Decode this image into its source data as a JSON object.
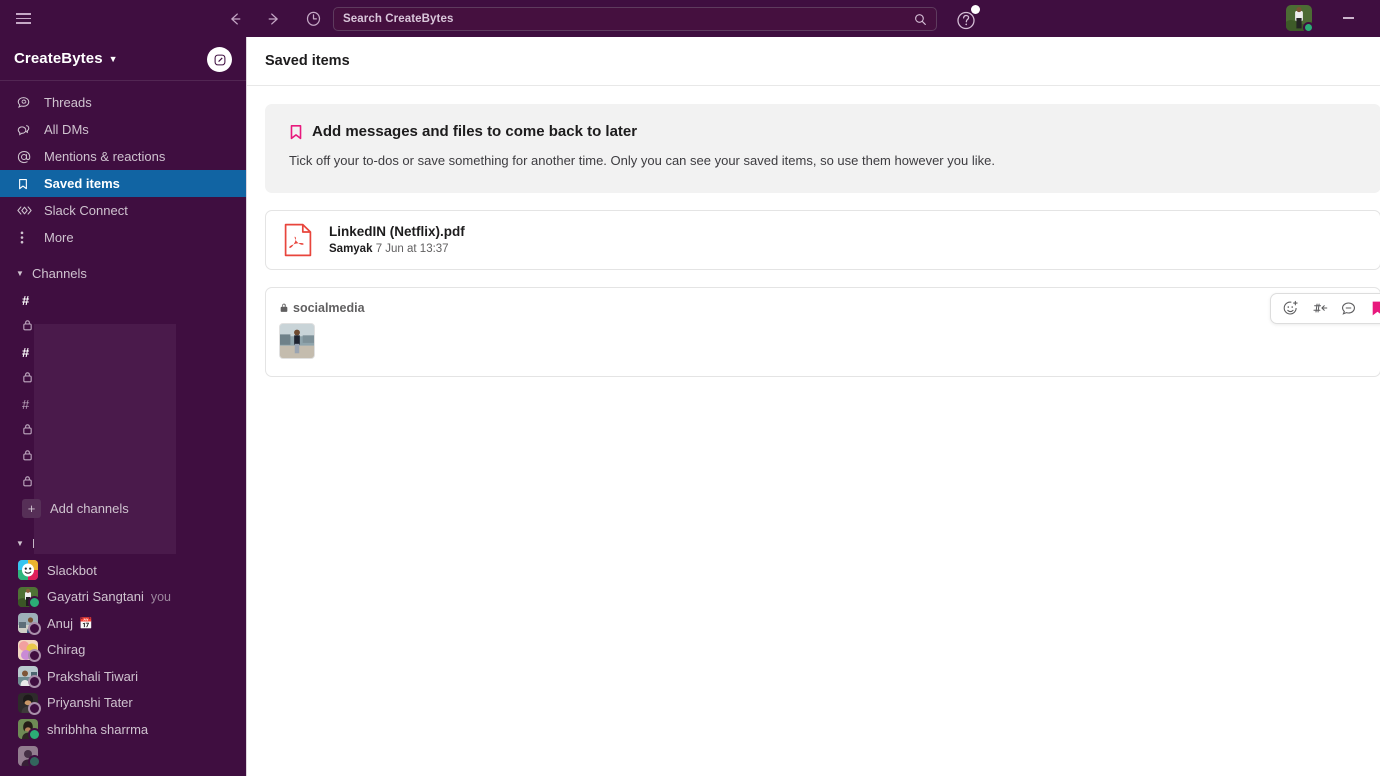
{
  "topbar": {
    "menu_icon": "hamburger-icon",
    "back_icon": "arrow-left-icon",
    "forward_icon": "arrow-right-icon",
    "history_icon": "clock-icon",
    "search_placeholder": "Search CreateBytes",
    "search_icon": "search-icon",
    "help_icon": "help-circle-icon",
    "help_badge": true,
    "avatar_name": "avatar",
    "presence": "active",
    "minimize_label": "Minimize"
  },
  "sidebar": {
    "workspace": "CreateBytes",
    "workspace_caret": "chevron-down-icon",
    "compose_icon": "compose-icon",
    "nav": [
      {
        "label": "Threads",
        "icon": "threads-icon",
        "active": false
      },
      {
        "label": "All DMs",
        "icon": "dms-icon",
        "active": false
      },
      {
        "label": "Mentions & reactions",
        "icon": "mentions-icon",
        "active": false
      },
      {
        "label": "Saved items",
        "icon": "bookmark-icon",
        "active": true
      },
      {
        "label": "Slack Connect",
        "icon": "slack-connect-icon",
        "active": false
      },
      {
        "label": "More",
        "icon": "more-vertical-icon",
        "active": false
      }
    ],
    "channels_section": "Channels",
    "channels": [
      {
        "name": "",
        "type": "public",
        "unread": true
      },
      {
        "name": "",
        "type": "private",
        "unread": false
      },
      {
        "name": "",
        "type": "public",
        "unread": true
      },
      {
        "name": "",
        "type": "private",
        "unread": false
      },
      {
        "name": "",
        "type": "public",
        "unread": false
      },
      {
        "name": "",
        "type": "private",
        "unread": false
      },
      {
        "name": "",
        "type": "private",
        "unread": false
      },
      {
        "name": "",
        "type": "private",
        "unread": false
      }
    ],
    "add_channels": "Add channels",
    "add_icon": "plus-icon",
    "dm_section": "Direct messages",
    "dms": [
      {
        "name": "Slackbot",
        "presence": "none",
        "suffix": "",
        "emoji": ""
      },
      {
        "name": "Gayatri Sangtani",
        "presence": "on",
        "suffix": "you",
        "emoji": ""
      },
      {
        "name": "Anuj",
        "presence": "off",
        "suffix": "",
        "emoji": "📅"
      },
      {
        "name": "Chirag",
        "presence": "off",
        "suffix": "",
        "emoji": ""
      },
      {
        "name": "Prakshali Tiwari",
        "presence": "off",
        "suffix": "",
        "emoji": ""
      },
      {
        "name": "Priyanshi Tater",
        "presence": "off",
        "suffix": "",
        "emoji": ""
      },
      {
        "name": "shribhha sharrma",
        "presence": "on",
        "suffix": "",
        "emoji": ""
      }
    ]
  },
  "main": {
    "title": "Saved items",
    "banner": {
      "icon": "bookmark-icon",
      "title": "Add messages and files to come back to later",
      "subtitle": "Tick off your to-dos or save something for another time. Only you can see your saved items, so use them however you like."
    },
    "file_item": {
      "icon": "pdf-file-icon",
      "name": "LinkedIN (Netflix).pdf",
      "author": "Samyak",
      "timestamp": "7 Jun at 13:37"
    },
    "message_item": {
      "channel": "socialmedia",
      "channel_icon": "lock-icon",
      "attachment": "image-thumbnail"
    },
    "hover_actions": [
      {
        "icon": "emoji-add-icon",
        "name": "add-reaction"
      },
      {
        "icon": "forward-icon",
        "name": "forward-message"
      },
      {
        "icon": "thread-reply-icon",
        "name": "reply-in-thread"
      },
      {
        "icon": "bookmark-filled-icon",
        "name": "remove-from-saved"
      }
    ]
  },
  "colors": {
    "sidebar_bg": "#3F0E40",
    "active_item": "#1164A3",
    "accent_pink": "#E8197D",
    "presence_green": "#2BAC76",
    "pdf_red": "#E8453C"
  }
}
